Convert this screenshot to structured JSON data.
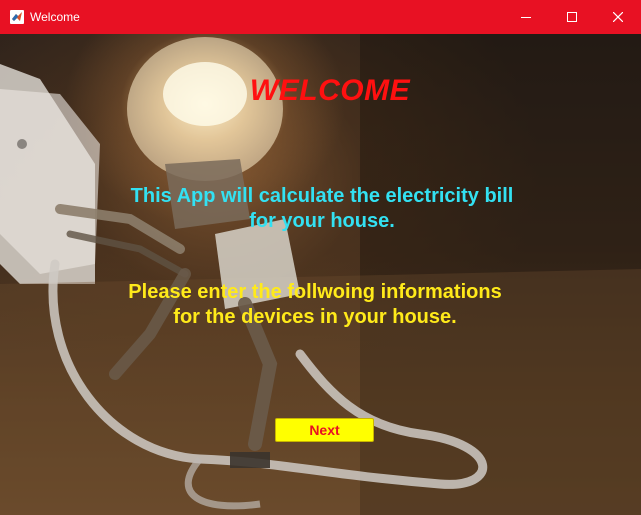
{
  "window": {
    "title": "Welcome",
    "icon": "matlab-icon",
    "controls": [
      "minimize-icon",
      "maximize-icon",
      "close-icon"
    ],
    "titlebar_color": "#e81123"
  },
  "main": {
    "heading": "WELCOME",
    "message1": [
      "This App will calculate the electricity bill",
      "for your house."
    ],
    "message2": [
      "Please enter the follwoing informations",
      "for the devices in your house."
    ],
    "next_label": "Next",
    "colors": {
      "heading": "#ff1010",
      "message1": "#33e1f2",
      "message2": "#ffea1a",
      "button_bg": "#ffff00",
      "button_text": "#e81123"
    },
    "background_image": "lightbulb-character-image"
  }
}
